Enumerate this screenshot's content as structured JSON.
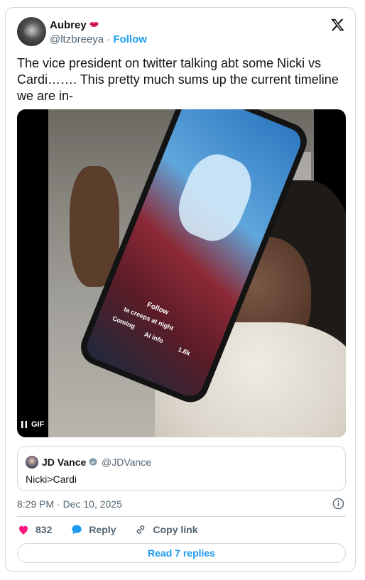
{
  "author": {
    "name": "Aubrey",
    "name_emoji_icon": "lips-icon",
    "handle": "@ltzbreeya",
    "separator": "·",
    "follow_label": "Follow"
  },
  "brand_icon": "x-logo-icon",
  "tweet": {
    "text": "The vice president on twitter talking abt some Nicki vs Cardi……. This pretty much sums up the current timeline we are in-"
  },
  "media": {
    "badge": "GIF",
    "pause_icon": "pause-icon",
    "screen_texts": {
      "follow": "Follow",
      "caption": "ta creeps at night",
      "coming": "Coming",
      "info": "AI info",
      "likes": "1.6k"
    }
  },
  "quoted_tweet": {
    "name": "JD Vance",
    "verified_icon": "verified-badge-icon",
    "handle": "@JDVance",
    "text": "Nicki>Cardi"
  },
  "timestamp": "8:29 PM · Dec 10, 2025",
  "actions": {
    "like_count": "832",
    "reply_label": "Reply",
    "copy_link_label": "Copy link"
  },
  "read_replies_label": "Read 7 replies",
  "colors": {
    "accent": "#1d9bf0",
    "like": "#f91880",
    "text": "#0f1419",
    "secondary": "#536471",
    "border": "#cfd9de"
  }
}
